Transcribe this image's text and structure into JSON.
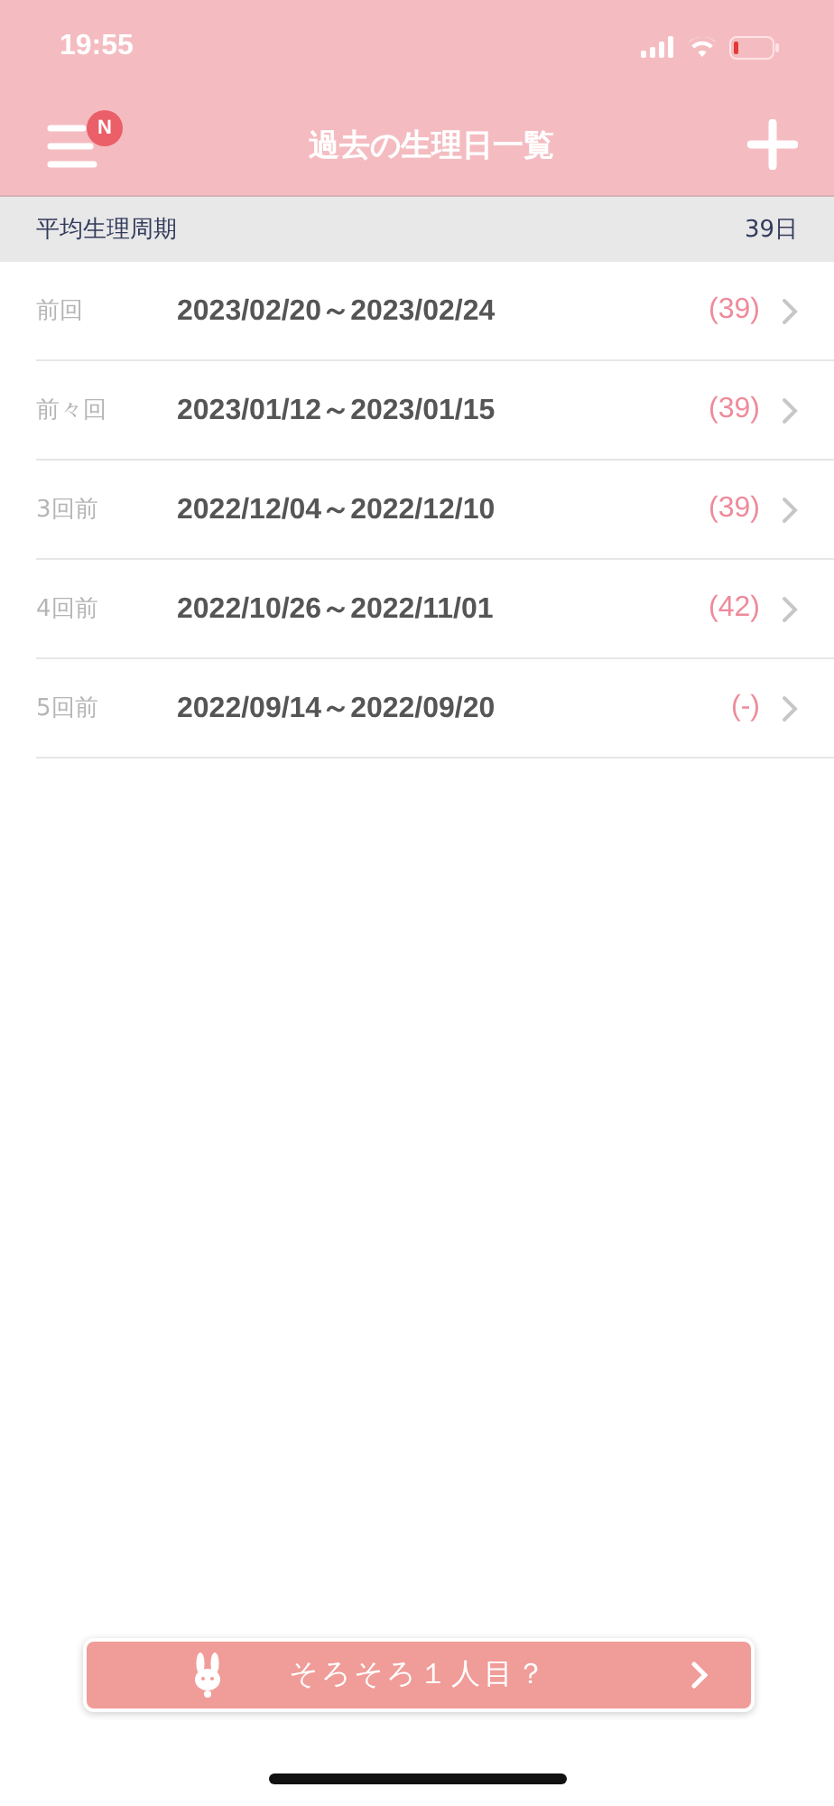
{
  "status_bar": {
    "time": "19:55"
  },
  "nav": {
    "title": "過去の生理日一覧",
    "menu_badge": "N"
  },
  "summary": {
    "label": "平均生理周期",
    "value": "39日"
  },
  "periods": [
    {
      "label": "前回",
      "range": "2023/02/20～2023/02/24",
      "cycle": "(39)"
    },
    {
      "label": "前々回",
      "range": "2023/01/12～2023/01/15",
      "cycle": "(39)"
    },
    {
      "label": "3回前",
      "range": "2022/12/04～2022/12/10",
      "cycle": "(39)"
    },
    {
      "label": "4回前",
      "range": "2022/10/26～2022/11/01",
      "cycle": "(42)"
    },
    {
      "label": "5回前",
      "range": "2022/09/14～2022/09/20",
      "cycle": "(-)"
    }
  ],
  "banner": {
    "text": "そろそろ１人目？"
  }
}
